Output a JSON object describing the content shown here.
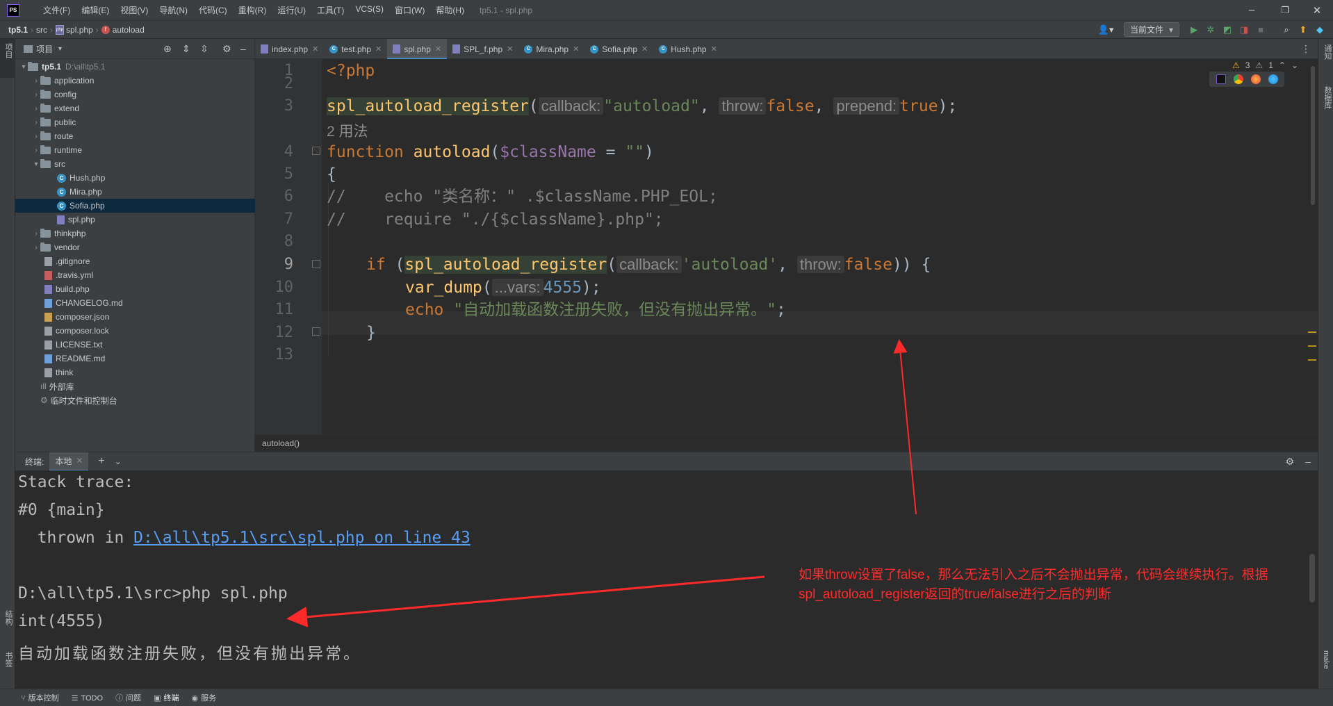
{
  "app": {
    "logo": "PS",
    "menus": [
      "文件(F)",
      "编辑(E)",
      "视图(V)",
      "导航(N)",
      "代码(C)",
      "重构(R)",
      "运行(U)",
      "工具(T)",
      "VCS(S)",
      "窗口(W)",
      "帮助(H)"
    ],
    "title": "tp5.1 - spl.php",
    "minimize": "–",
    "maximize": "❐",
    "close": "✕"
  },
  "breadcrumb": {
    "project": "tp5.1",
    "folder": "src",
    "file": "spl.php",
    "symbol": "autoload"
  },
  "toolbar": {
    "run_config": "当前文件",
    "run_config_arrow": "▾"
  },
  "left_strip": {
    "project_label": "项目",
    "structure_label": "结构",
    "bookmarks_label": "书签"
  },
  "right_strip": {
    "notifications_label": "通知",
    "database_label": "数据库",
    "make_label": "make"
  },
  "project_panel": {
    "title": "项目",
    "tree": [
      {
        "label": "tp5.1",
        "path": "D:\\all\\tp5.1",
        "type": "root"
      },
      {
        "label": "application",
        "type": "folder"
      },
      {
        "label": "config",
        "type": "folder"
      },
      {
        "label": "extend",
        "type": "folder"
      },
      {
        "label": "public",
        "type": "folder"
      },
      {
        "label": "route",
        "type": "folder"
      },
      {
        "label": "runtime",
        "type": "folder"
      },
      {
        "label": "src",
        "type": "folder-open"
      },
      {
        "label": "Hush.php",
        "type": "class"
      },
      {
        "label": "Mira.php",
        "type": "class"
      },
      {
        "label": "Sofia.php",
        "type": "class"
      },
      {
        "label": "spl.php",
        "type": "php"
      },
      {
        "label": "thinkphp",
        "type": "folder"
      },
      {
        "label": "vendor",
        "type": "folder"
      },
      {
        "label": ".gitignore",
        "type": "file"
      },
      {
        "label": ".travis.yml",
        "type": "yml"
      },
      {
        "label": "build.php",
        "type": "php"
      },
      {
        "label": "CHANGELOG.md",
        "type": "md"
      },
      {
        "label": "composer.json",
        "type": "json"
      },
      {
        "label": "composer.lock",
        "type": "file"
      },
      {
        "label": "LICENSE.txt",
        "type": "file"
      },
      {
        "label": "README.md",
        "type": "md"
      },
      {
        "label": "think",
        "type": "file"
      },
      {
        "label": "外部库",
        "type": "lib"
      },
      {
        "label": "临时文件和控制台",
        "type": "scratch"
      }
    ]
  },
  "tabs": [
    {
      "label": "index.php",
      "icon": "php"
    },
    {
      "label": "test.php",
      "icon": "class"
    },
    {
      "label": "spl.php",
      "icon": "php",
      "active": true
    },
    {
      "label": "SPL_f.php",
      "icon": "php"
    },
    {
      "label": "Mira.php",
      "icon": "class"
    },
    {
      "label": "Sofia.php",
      "icon": "class"
    },
    {
      "label": "Hush.php",
      "icon": "class"
    }
  ],
  "editor": {
    "warnings": "3",
    "weak_warnings": "1",
    "line_numbers": [
      "1",
      "2",
      "3",
      "4",
      "5",
      "6",
      "7",
      "8",
      "9",
      "10",
      "11",
      "12",
      "13"
    ],
    "usages_hint": "2 用法",
    "code": {
      "l1": "<?php",
      "l3_fn": "spl_autoload_register",
      "l3_hint1": "callback:",
      "l3_arg1": "\"autoload\"",
      "l3_hint2": "throw:",
      "l3_arg2": "false",
      "l3_hint3": "prepend:",
      "l3_arg3": "true",
      "l4_kw": "function",
      "l4_name": "autoload",
      "l4_param": "$className",
      "l4_default": "\"\"",
      "l5": "{",
      "l6": "//    echo \"类名称：\" .$className.PHP_EOL;",
      "l7": "//    require \"./{$className}.php\";",
      "l9_kw": "if",
      "l9_fn": "spl_autoload_register",
      "l9_hint1": "callback:",
      "l9_arg1": "'autoload'",
      "l9_hint2": "throw:",
      "l9_arg2": "false",
      "l10_fn": "var_dump",
      "l10_hint": "...vars:",
      "l10_num": "4555",
      "l11_kw": "echo",
      "l11_str": "\"自动加载函数注册失败，但没有抛出异常。\"",
      "l12": "}"
    },
    "breadcrumb_footer": "autoload()"
  },
  "terminal": {
    "label": "终端:",
    "tab": "本地",
    "lines": {
      "t1": "Stack trace:",
      "t2": "#0 {main}",
      "t3_prefix": "  thrown in ",
      "t3_link": "D:\\all\\tp5.1\\src\\spl.php on line 43",
      "t5": "D:\\all\\tp5.1\\src>php spl.php",
      "t6": "int(4555)",
      "t7": "自动加载函数注册失败，但没有抛出异常。"
    }
  },
  "annotation": {
    "line1": "如果throw设置了false，那么无法引入之后不会抛出异常，代码会继续执行。根据",
    "line2": "spl_autoload_register返回的true/false进行之后的判断",
    "color": "#ff2b2b"
  },
  "statusbar": {
    "items": [
      "版本控制",
      "TODO",
      "问题",
      "终端",
      "服务"
    ]
  }
}
